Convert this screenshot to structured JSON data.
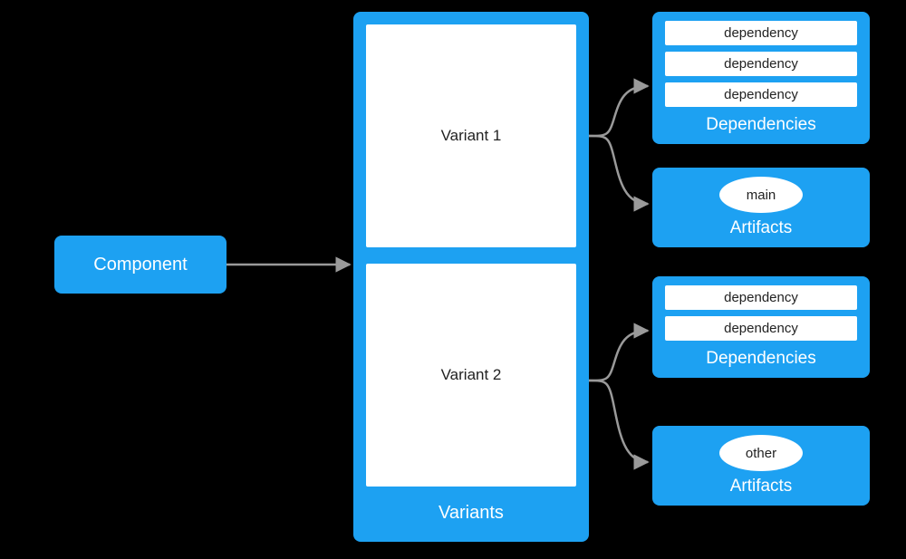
{
  "component": {
    "label": "Component"
  },
  "variants": {
    "title": "Variants",
    "items": [
      {
        "label": "Variant 1"
      },
      {
        "label": "Variant 2"
      }
    ]
  },
  "panels": {
    "deps1": {
      "title": "Dependencies",
      "items": [
        "dependency",
        "dependency",
        "dependency"
      ]
    },
    "arts1": {
      "title": "Artifacts",
      "items": [
        "main"
      ]
    },
    "deps2": {
      "title": "Dependencies",
      "items": [
        "dependency",
        "dependency"
      ]
    },
    "arts2": {
      "title": "Artifacts",
      "items": [
        "other"
      ]
    }
  },
  "colors": {
    "brand": "#1DA1F2",
    "background": "#000000",
    "card": "#FFFFFF"
  }
}
